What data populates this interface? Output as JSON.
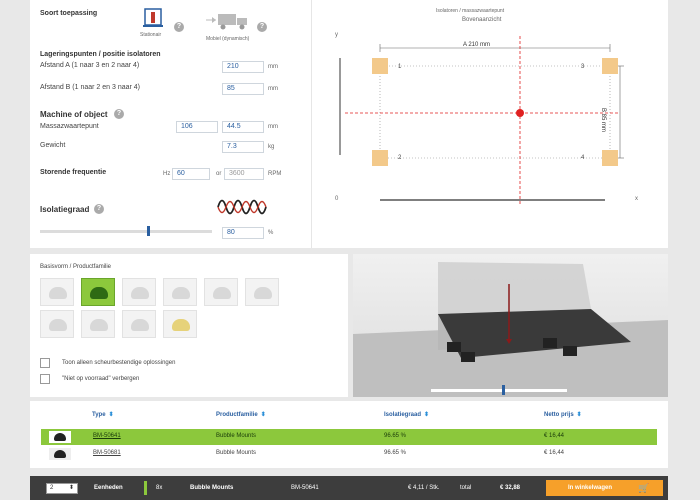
{
  "config": {
    "mounting_type_label": "Soort toepassing",
    "stationary_label": "Stationair",
    "mobile_label": "Mobiel (dynamisch)",
    "bearing_points_title": "Lageringspunten / positie isolatoren",
    "distance_a_label": "Afstand A (1 naar 3 en 2 naar 4)",
    "distance_a_value": "210",
    "distance_b_label": "Afstand B (1 naar 2 en 3 naar 4)",
    "distance_b_value": "85",
    "distance_unit": "mm",
    "machine_title": "Machine of object",
    "center_of_mass_label": "Massazwaartepunt",
    "com_x_value": "106",
    "com_y_value": "44.5",
    "weight_label": "Gewicht",
    "weight_value": "7.3",
    "weight_unit": "kg",
    "frequency_label": "Storende frequentie",
    "hz_unit": "Hz",
    "hz_value": "60",
    "or_label": "or",
    "rpm_value": "3600",
    "rpm_unit": "RPM",
    "isolation_label": "Isolatiegraad",
    "isolation_value": "80",
    "isolation_unit": "%",
    "isolation_slider_fraction": 0.62
  },
  "diagram": {
    "title": "Isolatoren / massazwaartepunt",
    "subtitle": "Bovenaanzicht",
    "y_axis": "y",
    "x_axis": "x",
    "origin": "0",
    "dim_a": "A 210 mm",
    "dim_b": "B 85 mm",
    "corners": [
      "1",
      "2",
      "3",
      "4"
    ]
  },
  "products": {
    "title": "Basisvorm / Productfamilie",
    "option_tear": "Toon alleen scheurbestendige oplossingen",
    "option_stock": "\"Niet op voorraad\" verbergen",
    "viewer_slider_fraction": 0.52
  },
  "table": {
    "headers": [
      "Type",
      "Productfamilie",
      "Isolatiegraad",
      "Netto prijs"
    ],
    "rows": [
      {
        "type": "BM-50641",
        "family": "Bubble Mounts",
        "isolation": "96.65 %",
        "price": "€ 16,44"
      },
      {
        "type": "BM-50681",
        "family": "Bubble Mounts",
        "isolation": "96.65 %",
        "price": "€ 16,44"
      }
    ]
  },
  "footer": {
    "quantity": "2",
    "units_label": "Eenheden",
    "multiplier": "8x",
    "family": "Bubble Mounts",
    "type": "BM-50641",
    "unit_price": "€ 4,11 / Stk.",
    "total_label": "total",
    "total_value": "€ 32,88",
    "cart_button": "In winkelwagen"
  },
  "colors": {
    "accent_green": "#8cc83c",
    "cart_orange": "#f6a02a",
    "footer_bg": "#3d3d3d",
    "axis_red": "#e02020",
    "pad_tan": "#f3c98a"
  }
}
